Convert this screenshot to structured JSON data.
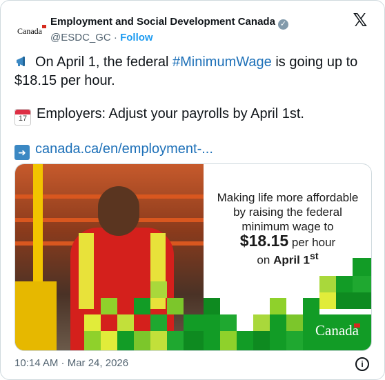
{
  "author": {
    "avatar_text": "Canada",
    "display_name": "Employment and Social Development Canada",
    "handle": "@ESDC_GC",
    "separator": "·",
    "follow_label": "Follow",
    "verified_icon": "verified-badge-icon"
  },
  "platform_icon": "x-logo-icon",
  "tweet": {
    "line1_prefix": "On April 1, the federal ",
    "line1_hashtag": "#MinimumWage",
    "line1_suffix": " is going up to $18.15 per hour.",
    "line2_calendar_day": "17",
    "line2_text": "Employers: Adjust your payrolls by April 1st.",
    "line3_link": "canada.ca/en/employment-..."
  },
  "media": {
    "headline_1": "Making life more affordable by raising the federal minimum wage to",
    "amount": "$18.15",
    "per_hour": " per hour",
    "on_prefix": "on ",
    "date": "April 1",
    "date_sup": "st",
    "wordmark": "Canada"
  },
  "footer": {
    "timestamp": "10:14 AM · Mar 24, 2026",
    "info_icon_glyph": "i"
  },
  "colors": {
    "link": "#1d70b8",
    "follow": "#1d9bf0",
    "muted": "#536471",
    "green_dark": "#129c26",
    "green_light": "#8fd12b",
    "yellow": "#e1ec3a"
  }
}
